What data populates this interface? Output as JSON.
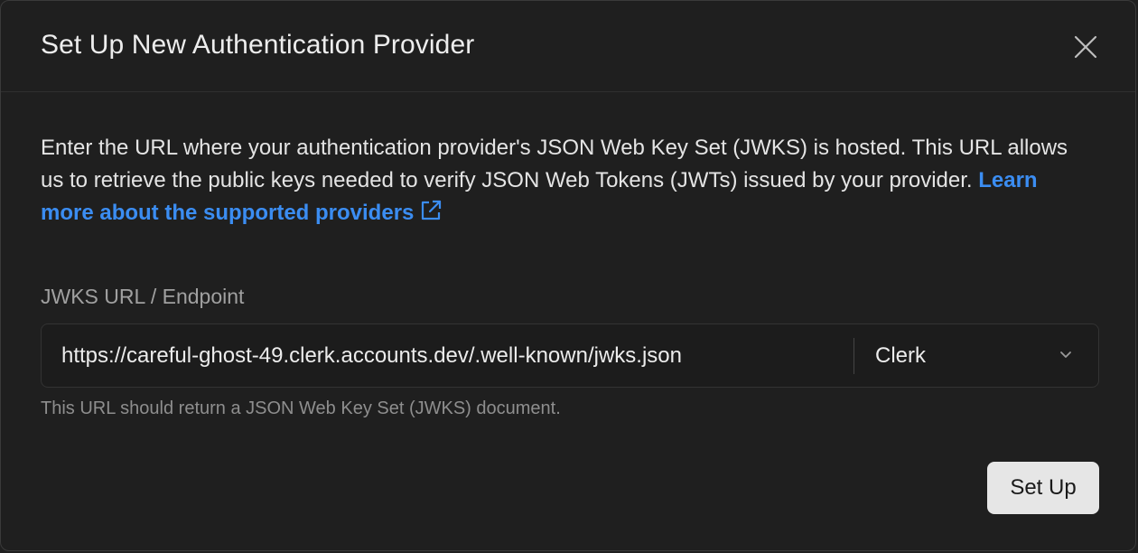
{
  "dialog": {
    "title": "Set Up New Authentication Provider",
    "close_icon": "close-icon",
    "description": "Enter the URL where your authentication provider's JSON Web Key Set (JWKS) is hosted. This URL allows us to retrieve the public keys needed to verify JSON Web Tokens (JWTs) issued by your provider.",
    "learn_more_link": "Learn more about the supported providers",
    "external_link_icon": "external-link-icon",
    "link_color": "#3b8df2"
  },
  "form": {
    "label": "JWKS URL / Endpoint",
    "url_value": "https://careful-ghost-49.clerk.accounts.dev/.well-known/jwks.json",
    "provider_selected": "Clerk",
    "chevron_icon": "chevron-down-icon",
    "help_text": "This URL should return a JSON Web Key Set (JWKS) document."
  },
  "footer": {
    "submit_label": "Set Up"
  }
}
